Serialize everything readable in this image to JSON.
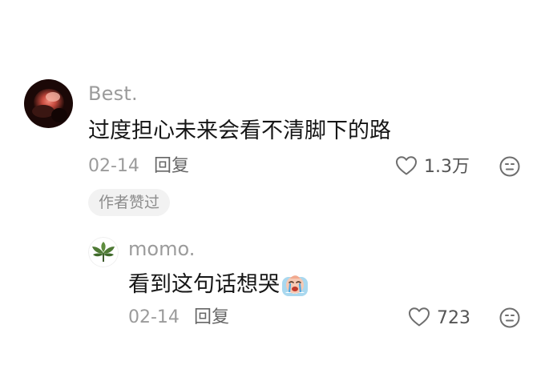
{
  "main_comment": {
    "username": "Best.",
    "text": "过度担心未来会看不清脚下的路",
    "date": "02-14",
    "reply_label": "回复",
    "like_count": "1.3万",
    "author_badge": "作者赞过"
  },
  "reply_comment": {
    "username": "momo.",
    "text": "看到这句话想哭",
    "date": "02-14",
    "reply_label": "回复",
    "like_count": "723"
  },
  "icons": {
    "like": "heart-icon",
    "emoji": "smiley-icon",
    "sticker": "crying-face-sticker"
  },
  "colors": {
    "text_primary": "#161616",
    "text_secondary": "#9b9b9b",
    "badge_bg": "#f2f2f2"
  }
}
